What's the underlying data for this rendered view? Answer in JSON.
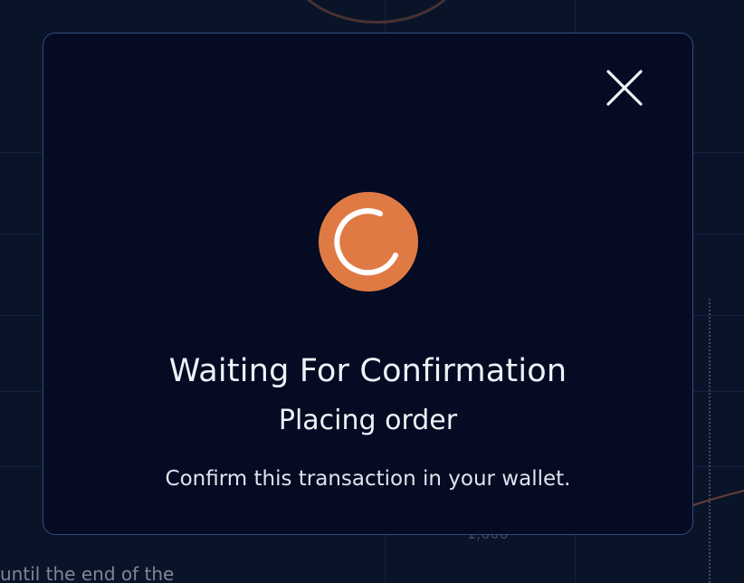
{
  "modal": {
    "title": "Waiting For Confirmation",
    "subtitle": "Placing order",
    "hint": "Confirm this transaction in your wallet."
  },
  "icons": {
    "close": "close-icon",
    "spinner": "loading-spinner-icon"
  },
  "background": {
    "axis_label": "1,000",
    "text_fragment": "until the end of the"
  },
  "colors": {
    "modal_bg": "#040b22",
    "modal_border": "#2c4f86",
    "spinner": "#e07a44",
    "text": "#eef1f7"
  }
}
